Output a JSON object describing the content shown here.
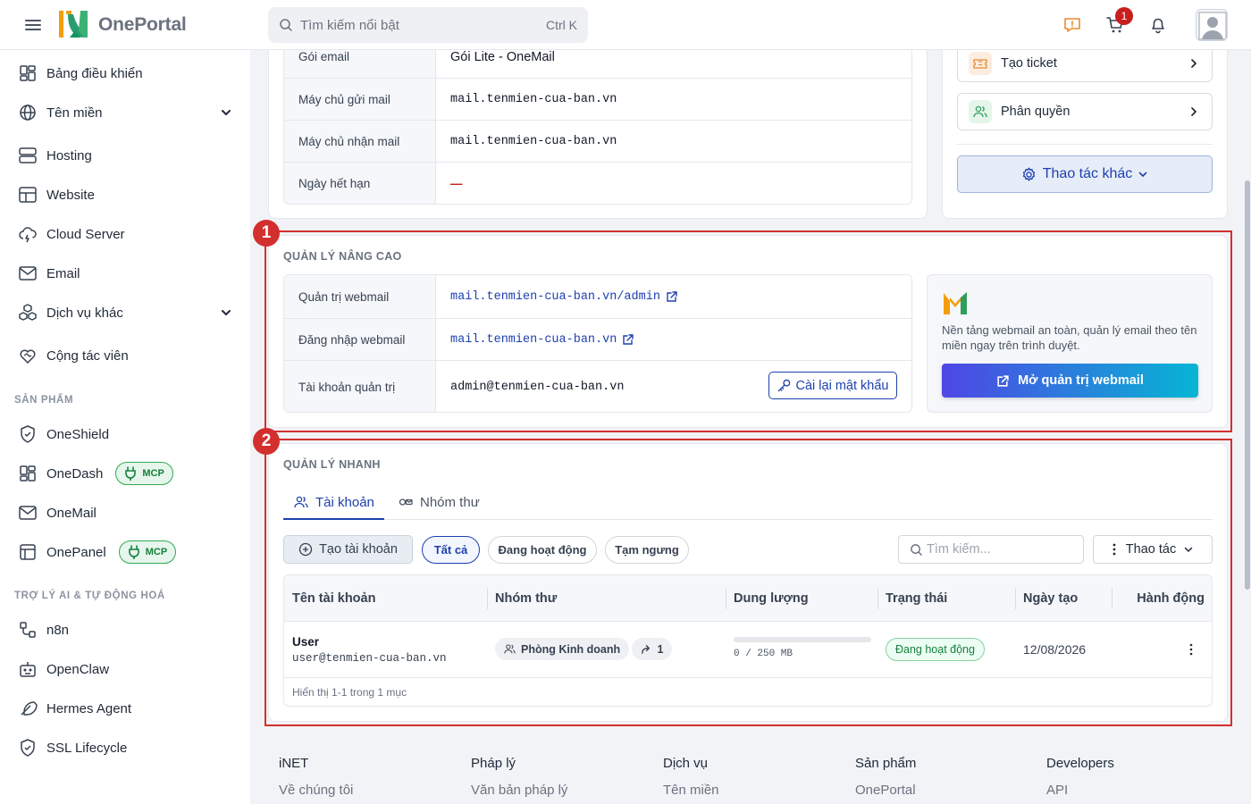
{
  "topbar": {
    "logo_text": "OnePortal",
    "search_placeholder": "Tìm kiếm nổi bật",
    "search_shortcut": "Ctrl K",
    "cart_count": "1"
  },
  "sidebar": {
    "items": [
      {
        "label": "Bảng điều khiển"
      },
      {
        "label": "Tên miền"
      },
      {
        "label": "Hosting"
      },
      {
        "label": "Website"
      },
      {
        "label": "Cloud Server"
      },
      {
        "label": "Email"
      },
      {
        "label": "Dịch vụ khác"
      },
      {
        "label": "Cộng tác viên"
      }
    ],
    "products_label": "SẢN PHẨM",
    "products": [
      {
        "label": "OneShield"
      },
      {
        "label": "OneDash",
        "badge": "MCP"
      },
      {
        "label": "OneMail"
      },
      {
        "label": "OnePanel",
        "badge": "MCP"
      }
    ],
    "ai_label": "TRỢ LÝ AI & TỰ ĐỘNG HOÁ",
    "ai_items": [
      {
        "label": "n8n"
      },
      {
        "label": "OpenClaw"
      },
      {
        "label": "Hermes Agent"
      },
      {
        "label": "SSL Lifecycle"
      }
    ]
  },
  "info": {
    "rows": [
      {
        "key": "Gói email",
        "value": "Gói Lite - OneMail"
      },
      {
        "key": "Máy chủ gửi mail",
        "value": "mail.tenmien-cua-ban.vn"
      },
      {
        "key": "Máy chủ nhận mail",
        "value": "mail.tenmien-cua-ban.vn"
      },
      {
        "key": "Ngày hết hạn",
        "value": "—"
      }
    ]
  },
  "actions": {
    "create_ticket": "Tạo ticket",
    "permissions": "Phân quyền",
    "more": "Thao tác khác"
  },
  "advanced": {
    "number": "1",
    "title": "QUẢN LÝ NÂNG CAO",
    "rows": [
      {
        "key": "Quản trị webmail",
        "value": "mail.tenmien-cua-ban.vn/admin"
      },
      {
        "key": "Đăng nhập webmail",
        "value": "mail.tenmien-cua-ban.vn"
      },
      {
        "key": "Tài khoản quản trị",
        "value": "admin@tenmien-cua-ban.vn"
      }
    ],
    "reset_password": "Cài lại mật khẩu",
    "promo_text": "Nền tảng webmail an toàn, quản lý email theo tên miền ngay trên trình duyệt.",
    "open_webmail": "Mở quản trị webmail"
  },
  "quick": {
    "number": "2",
    "title": "QUẢN LÝ NHANH",
    "tabs": [
      {
        "label": "Tài khoản"
      },
      {
        "label": "Nhóm thư"
      }
    ],
    "create_account": "Tạo tài khoản",
    "filters": [
      {
        "label": "Tất cả"
      },
      {
        "label": "Đang hoạt động"
      },
      {
        "label": "Tạm ngưng"
      }
    ],
    "search_placeholder": "Tìm kiếm...",
    "bulk_action": "Thao tác",
    "columns": [
      "Tên tài khoản",
      "Nhóm thư",
      "Dung lượng",
      "Trạng thái",
      "Ngày tạo",
      "Hành động"
    ],
    "rows": [
      {
        "name": "User",
        "email": "user@tenmien-cua-ban.vn",
        "group": "Phòng Kinh doanh",
        "forward_count": "1",
        "usage": "0 / 250 MB",
        "usage_fraction": 0,
        "status": "Đang hoạt động",
        "created": "12/08/2026"
      }
    ],
    "pagination": "Hiển thị 1-1 trong 1 mục"
  },
  "footer": {
    "columns": [
      {
        "title": "iNET",
        "link": "Về chúng tôi"
      },
      {
        "title": "Pháp lý",
        "link": "Văn bản pháp lý"
      },
      {
        "title": "Dịch vụ",
        "link": "Tên miền"
      },
      {
        "title": "Sản phẩm",
        "link": "OnePortal"
      },
      {
        "title": "Developers",
        "link": "API"
      }
    ]
  },
  "colors": {
    "accent": "#1e40af",
    "annotation": "#d32f2f",
    "badge_red": "#c81e1e",
    "mcp_green": "#15803d",
    "gradient_start": "#4f46e5",
    "gradient_end": "#06b6d4"
  }
}
